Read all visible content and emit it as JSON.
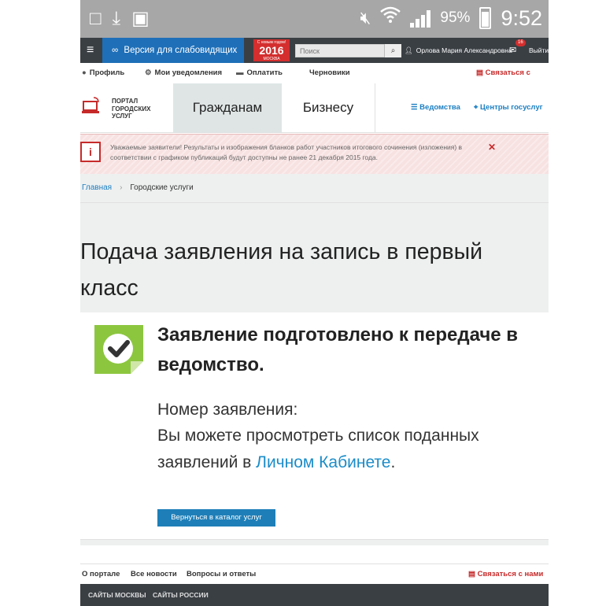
{
  "status_bar": {
    "battery": "95%",
    "time": "9:52"
  },
  "topnav": {
    "accessibility": "Версия для слабовидящих",
    "logo_top": "С новым годом!",
    "logo_year": "2016",
    "logo_bottom": "МОСКВА",
    "search_placeholder": "Поиск",
    "user": "Орлова Мария Александровна",
    "mail_count": "16",
    "logout": "Выйти"
  },
  "subnav": {
    "profile": "Профиль",
    "notifications": "Мои уведомления",
    "pay": "Оплатить",
    "drafts": "Черновики",
    "contact": "Связаться с нами"
  },
  "portal": {
    "name_l1": "ПОРТАЛ",
    "name_l2": "ГОРОДСКИХ",
    "name_l3": "УСЛУГ",
    "tab_citizens": "Гражданам",
    "tab_business": "Бизнесу",
    "link_departments": "Ведомства",
    "link_centers": "Центры госуслуг"
  },
  "alert": {
    "text": "Уважаемые заявители! Результаты и изображения бланков работ участников итогового сочинения (изложения) в соответствии с графиком публикаций будут доступны не ранее 21 декабря 2015 года."
  },
  "breadcrumb": {
    "home": "Главная",
    "current": "Городские услуги"
  },
  "page_title": "Подача заявления на запись в первый класс",
  "result": {
    "heading": "Заявление подготовлено к передаче в ведомство.",
    "number_label": "Номер заявления:",
    "body_prefix": "Вы можете просмотреть список поданных заявлений в ",
    "body_link": "Личном Кабинете",
    "body_suffix": ".",
    "back_button": "Вернуться в каталог услуг"
  },
  "footer": {
    "about": "О портале",
    "news": "Все новости",
    "faq": "Вопросы и ответы",
    "contact": "Связаться с нами",
    "sites_moscow": "САЙТЫ МОСКВЫ",
    "sites_russia": "САЙТЫ РОССИИ"
  },
  "colors": {
    "accent_blue": "#1e6fb8",
    "brand_red": "#d42e2e",
    "check_green": "#8cc63f"
  },
  "icons": [
    "device-check-icon",
    "download-icon",
    "image-icon",
    "mute-icon",
    "wifi-icon",
    "signal-icon",
    "battery-icon",
    "menu-icon",
    "glasses-icon",
    "search-icon",
    "user-icon",
    "mail-icon",
    "user-profile-icon",
    "gear-icon",
    "card-icon",
    "chat-icon",
    "rss-icon",
    "laptop-icon",
    "list-icon",
    "location-icon",
    "info-icon",
    "close-icon",
    "checkmark-icon"
  ]
}
